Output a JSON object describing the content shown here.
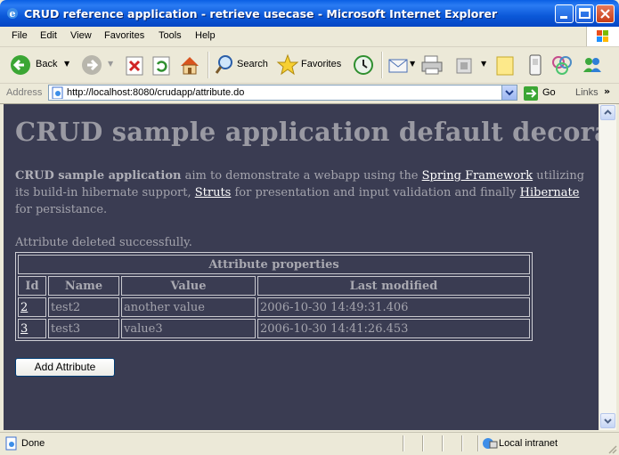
{
  "window": {
    "title": "CRUD reference application - retrieve usecase - Microsoft Internet Explorer"
  },
  "menu": [
    "File",
    "Edit",
    "View",
    "Favorites",
    "Tools",
    "Help"
  ],
  "toolbar": {
    "back_label": "Back",
    "search_label": "Search",
    "favorites_label": "Favorites"
  },
  "address": {
    "label": "Address",
    "url": "http://localhost:8080/crudapp/attribute.do",
    "go_label": "Go",
    "links_label": "Links"
  },
  "page": {
    "heading": "CRUD sample application default decorator",
    "intro": {
      "bold_lead": "CRUD sample application",
      "text1": " aim to demonstrate a webapp using the ",
      "link1": "Spring Framework",
      "text2": " utilizing its build-in hibernate support, ",
      "link2": "Struts",
      "text3": " for presentation and input validation and finally ",
      "link3": "Hibernate",
      "text4": " for persistance."
    },
    "message": "Attribute deleted successfully.",
    "table": {
      "caption": "Attribute properties",
      "headers": [
        "Id",
        "Name",
        "Value",
        "Last modified"
      ],
      "rows": [
        [
          "2",
          "test2",
          "another value",
          "2006-10-30 14:49:31.406"
        ],
        [
          "3",
          "test3",
          "value3",
          "2006-10-30 14:41:26.453"
        ]
      ]
    },
    "add_button": "Add Attribute"
  },
  "status": {
    "text": "Done",
    "zone": "Local intranet"
  }
}
